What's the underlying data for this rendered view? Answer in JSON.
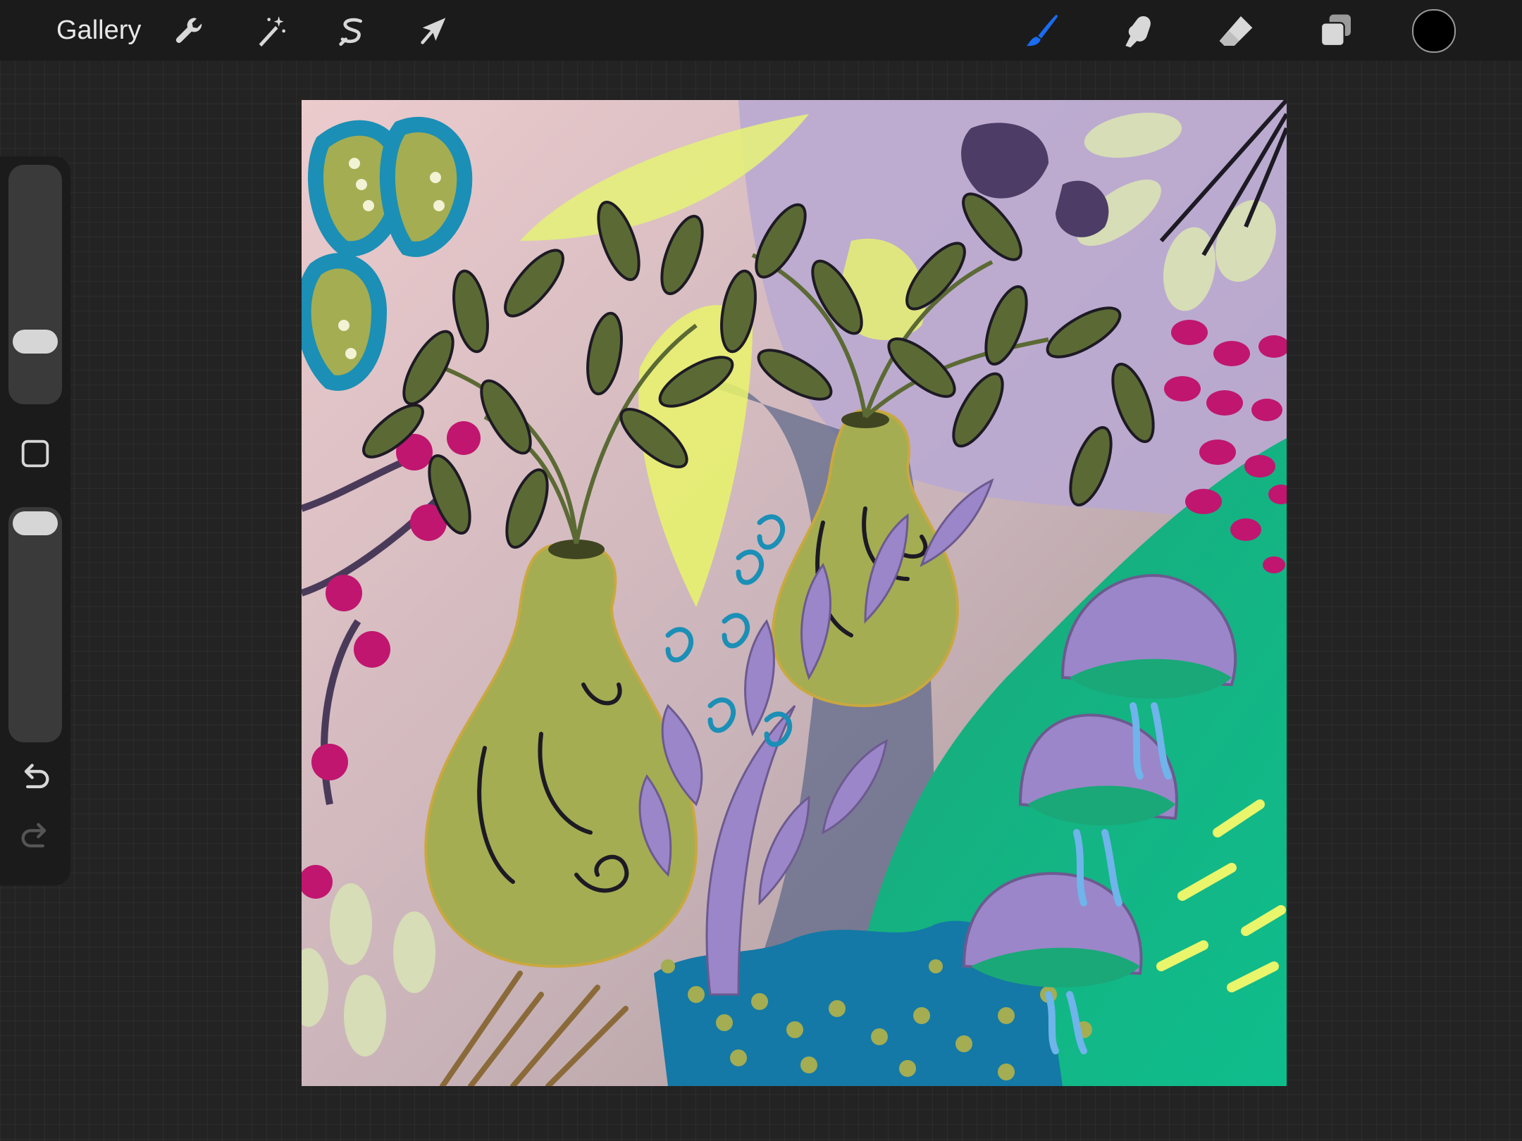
{
  "toolbar": {
    "gallery_label": "Gallery",
    "left_tools": [
      {
        "name": "actions",
        "icon": "wrench-icon"
      },
      {
        "name": "adjustments",
        "icon": "magic-wand-icon"
      },
      {
        "name": "selection",
        "icon": "selection-s-icon"
      },
      {
        "name": "transform",
        "icon": "arrow-cursor-icon"
      }
    ],
    "right_tools": [
      {
        "name": "brush",
        "icon": "brush-icon",
        "active": true
      },
      {
        "name": "smudge",
        "icon": "smudge-finger-icon"
      },
      {
        "name": "eraser",
        "icon": "eraser-icon"
      },
      {
        "name": "layers",
        "icon": "layers-icon"
      },
      {
        "name": "color",
        "icon": "color-swatch",
        "value": "#000000"
      }
    ],
    "active_color": "#1a6cf0"
  },
  "sidebar": {
    "brush_size_level": 0.26,
    "opacity_level": 0.95,
    "items": [
      {
        "name": "brush-size-slider"
      },
      {
        "name": "modify-button",
        "icon": "square-icon"
      },
      {
        "name": "opacity-slider"
      },
      {
        "name": "undo-button",
        "icon": "undo-icon"
      },
      {
        "name": "redo-button",
        "icon": "redo-icon",
        "enabled": false
      }
    ]
  },
  "canvas": {
    "artwork": "botanical-illustration",
    "palette": [
      "#e9c6c8",
      "#a4ad52",
      "#5b6a34",
      "#9b86c9",
      "#c0166f",
      "#1b8fb6",
      "#13b486",
      "#e9f56a",
      "#d7ddb6"
    ]
  }
}
